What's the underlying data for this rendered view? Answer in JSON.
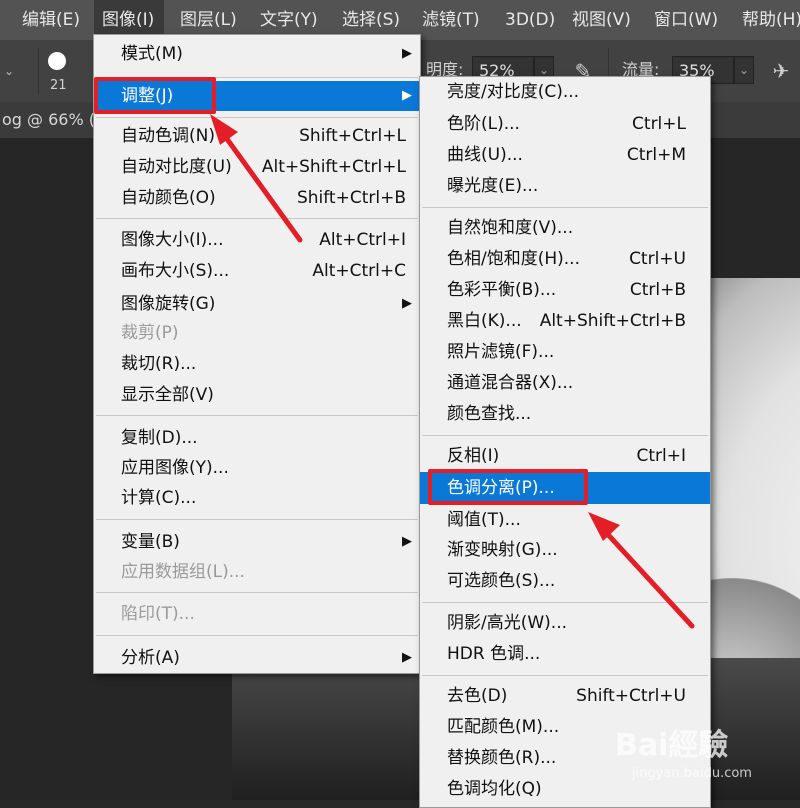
{
  "menubar": {
    "items": [
      {
        "label": "编辑(E)"
      },
      {
        "label": "图像(I)"
      },
      {
        "label": "图层(L)"
      },
      {
        "label": "文字(Y)"
      },
      {
        "label": "选择(S)"
      },
      {
        "label": "滤镜(T)"
      },
      {
        "label": "3D(D)"
      },
      {
        "label": "视图(V)"
      },
      {
        "label": "窗口(W)"
      },
      {
        "label": "帮助(H)"
      }
    ]
  },
  "options": {
    "brush_size": "21",
    "opacity_label": "明度:",
    "opacity_value": "52%",
    "flow_label": "流量:",
    "flow_value": "35%"
  },
  "doc_tab": {
    "label": "og @ 66% ("
  },
  "image_menu": {
    "items": [
      {
        "label": "模式(M)",
        "submenu": true
      },
      {
        "label": "调整(J)",
        "submenu": true,
        "highlighted": true
      },
      {
        "label": "自动色调(N)",
        "shortcut": "Shift+Ctrl+L"
      },
      {
        "label": "自动对比度(U)",
        "shortcut": "Alt+Shift+Ctrl+L"
      },
      {
        "label": "自动颜色(O)",
        "shortcut": "Shift+Ctrl+B"
      },
      {
        "label": "图像大小(I)...",
        "shortcut": "Alt+Ctrl+I"
      },
      {
        "label": "画布大小(S)...",
        "shortcut": "Alt+Ctrl+C"
      },
      {
        "label": "图像旋转(G)",
        "submenu": true
      },
      {
        "label": "裁剪(P)",
        "disabled": true
      },
      {
        "label": "裁切(R)..."
      },
      {
        "label": "显示全部(V)"
      },
      {
        "label": "复制(D)..."
      },
      {
        "label": "应用图像(Y)..."
      },
      {
        "label": "计算(C)..."
      },
      {
        "label": "变量(B)",
        "submenu": true
      },
      {
        "label": "应用数据组(L)...",
        "disabled": true
      },
      {
        "label": "陷印(T)...",
        "disabled": true
      },
      {
        "label": "分析(A)",
        "submenu": true
      }
    ]
  },
  "adjust_menu": {
    "items": [
      {
        "label": "亮度/对比度(C)..."
      },
      {
        "label": "色阶(L)...",
        "shortcut": "Ctrl+L"
      },
      {
        "label": "曲线(U)...",
        "shortcut": "Ctrl+M"
      },
      {
        "label": "曝光度(E)..."
      },
      {
        "label": "自然饱和度(V)..."
      },
      {
        "label": "色相/饱和度(H)...",
        "shortcut": "Ctrl+U"
      },
      {
        "label": "色彩平衡(B)...",
        "shortcut": "Ctrl+B"
      },
      {
        "label": "黑白(K)...",
        "shortcut": "Alt+Shift+Ctrl+B"
      },
      {
        "label": "照片滤镜(F)..."
      },
      {
        "label": "通道混合器(X)..."
      },
      {
        "label": "颜色查找..."
      },
      {
        "label": "反相(I)",
        "shortcut": "Ctrl+I"
      },
      {
        "label": "色调分离(P)...",
        "highlighted": true
      },
      {
        "label": "阈值(T)..."
      },
      {
        "label": "渐变映射(G)..."
      },
      {
        "label": "可选颜色(S)..."
      },
      {
        "label": "阴影/高光(W)..."
      },
      {
        "label": "HDR 色调..."
      },
      {
        "label": "去色(D)",
        "shortcut": "Shift+Ctrl+U"
      },
      {
        "label": "匹配颜色(M)..."
      },
      {
        "label": "替换颜色(R)..."
      },
      {
        "label": "色调均化(Q)"
      }
    ]
  },
  "watermark": {
    "brand": "Bai經驗",
    "url": "jingyan.baidu.com"
  },
  "colors": {
    "highlight": "#0a78d7",
    "annotation": "#e41e26",
    "menu_bg": "#f0f0f0",
    "menubar_bg": "#535353"
  },
  "icons": {
    "brush_preview": "brush-preview-icon",
    "airbrush": "airbrush-icon",
    "pressure": "pressure-icon"
  }
}
